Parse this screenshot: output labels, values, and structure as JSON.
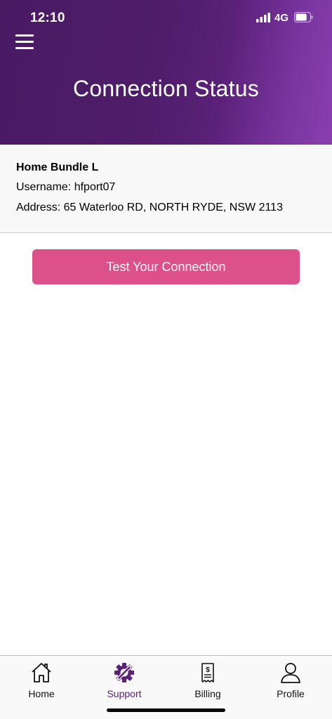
{
  "status_bar": {
    "time": "12:10",
    "network": "4G",
    "battery_level": 0.8
  },
  "header": {
    "title": "Connection Status",
    "menu_icon": "hamburger-menu-icon"
  },
  "account": {
    "plan_name": "Home Bundle L",
    "username_line": "Username: hfport07",
    "address_line": "Address: 65 Waterloo RD, NORTH RYDE, NSW 2113"
  },
  "actions": {
    "test_connection_label": "Test Your Connection"
  },
  "tabbar": {
    "active": "Support",
    "items": [
      {
        "label": "Home",
        "icon": "house-icon"
      },
      {
        "label": "Support",
        "icon": "gear-wrench-icon"
      },
      {
        "label": "Billing",
        "icon": "receipt-icon"
      },
      {
        "label": "Profile",
        "icon": "person-icon"
      }
    ]
  },
  "colors": {
    "header_start": "#4a1a63",
    "header_end": "#8a3eae",
    "accent_button": "#dd518a",
    "active_tab": "#5a2178"
  }
}
